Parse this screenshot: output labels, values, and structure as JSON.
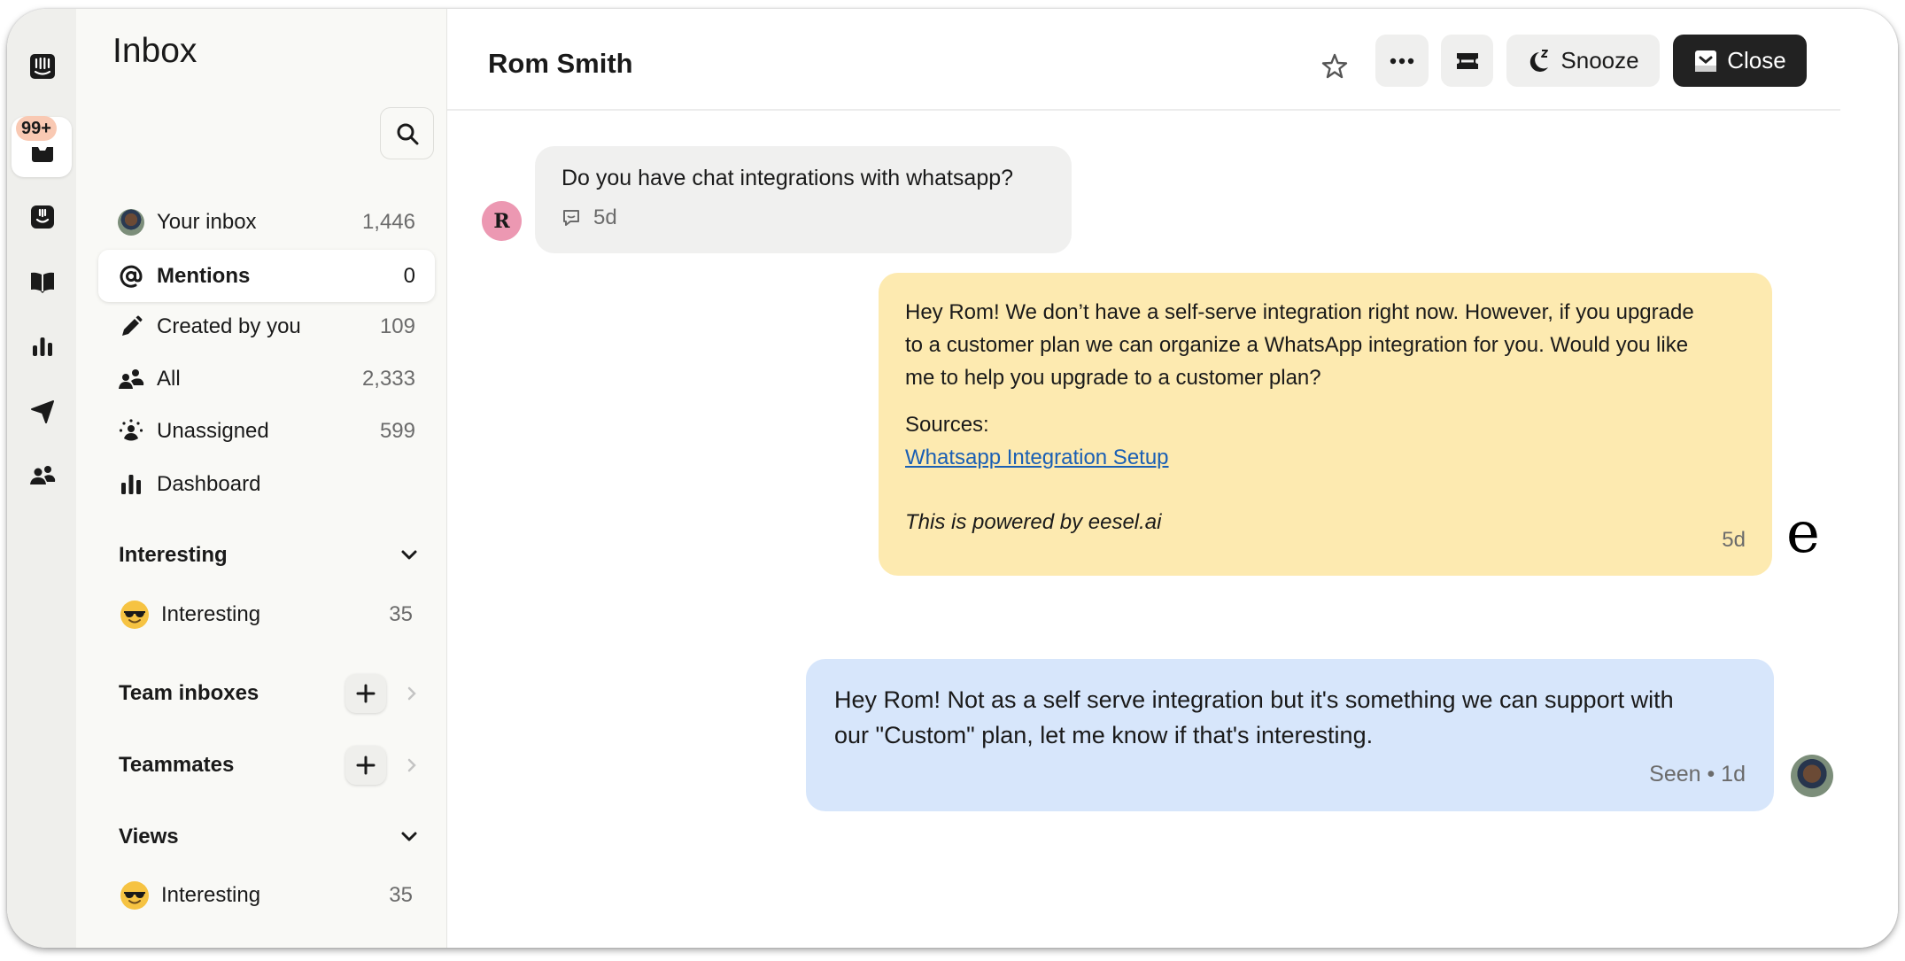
{
  "rail": {
    "badge": "99+",
    "icons": [
      "intercom-logo-icon",
      "inbox-icon",
      "fin-bot-icon",
      "knowledge-book-icon",
      "reports-chart-icon",
      "outbound-send-icon",
      "contacts-people-icon"
    ]
  },
  "sidebar": {
    "title": "Inbox",
    "search_icon": "search-icon",
    "items": [
      {
        "label": "Your inbox",
        "count": "1,446",
        "icon": "avatar"
      },
      {
        "label": "Mentions",
        "count": "0",
        "icon": "at-icon",
        "active": true
      },
      {
        "label": "Created by you",
        "count": "109",
        "icon": "pencil-icon"
      },
      {
        "label": "All",
        "count": "2,333",
        "icon": "people-icon"
      },
      {
        "label": "Unassigned",
        "count": "599",
        "icon": "unassigned-icon"
      },
      {
        "label": "Dashboard",
        "count": "",
        "icon": "bar-chart-icon"
      }
    ],
    "sections": {
      "interesting": {
        "title": "Interesting",
        "items": [
          {
            "label": "Interesting",
            "count": "35",
            "emoji": "😎"
          }
        ]
      },
      "team_inboxes": {
        "title": "Team inboxes"
      },
      "teammates": {
        "title": "Teammates"
      },
      "views": {
        "title": "Views",
        "items": [
          {
            "label": "Interesting",
            "count": "35",
            "emoji": "😎"
          }
        ]
      }
    }
  },
  "header": {
    "title": "Rom Smith",
    "snooze_label": "Snooze",
    "close_label": "Close"
  },
  "messages": {
    "customer": {
      "avatar_initial": "R",
      "text": "Do you have chat integrations with whatsapp?",
      "time": "5d"
    },
    "bot": {
      "line1": "Hey Rom! We don’t have a self-serve integration right now. However, if you upgrade",
      "line2": "to a customer plan we can organize a WhatsApp integration for you. Would you like",
      "line3": "me to help you upgrade to a customer plan?",
      "sources_label": "Sources:",
      "source_link": "Whatsapp Integration Setup",
      "powered_by": "This is powered by eesel.ai",
      "time": "5d",
      "logo": "e"
    },
    "agent": {
      "line1": "Hey Rom! Not as a self serve integration but it's something we can support with",
      "line2": "our \"Custom\" plan, let me know if that's interesting.",
      "meta": "Seen • 1d"
    }
  },
  "colors": {
    "bot_bubble": "#fdeab0",
    "agent_bubble": "#d7e6fb",
    "customer_bubble": "#f0f0ef",
    "link": "#1a5fb4",
    "badge": "#f9c9b3",
    "customer_avatar": "#ec98b2"
  }
}
